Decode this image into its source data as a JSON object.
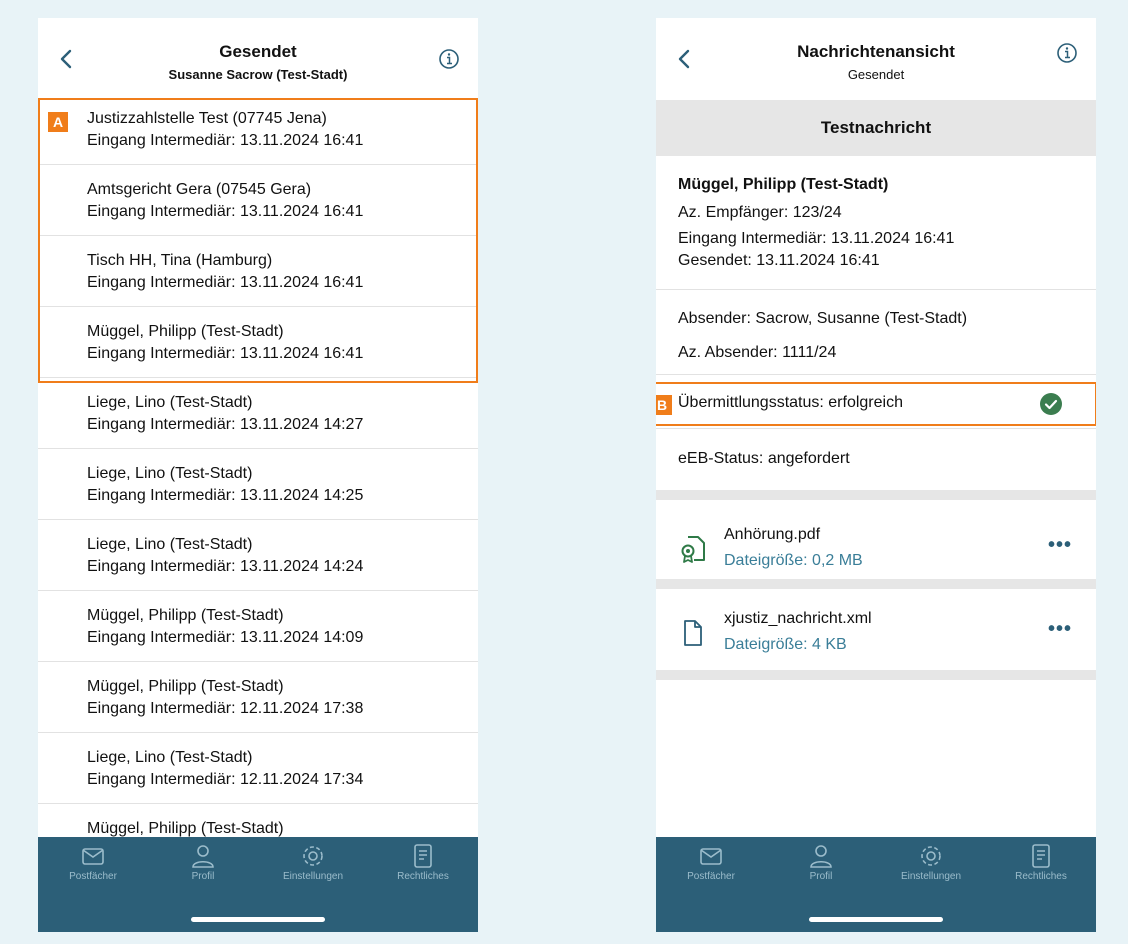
{
  "left": {
    "header": {
      "title": "Gesendet",
      "subtitle": "Susanne Sacrow (Test-Stadt)"
    },
    "badge": "A",
    "messages": [
      {
        "sender": "Justizzahlstelle Test (07745 Jena)",
        "received": "Eingang Intermediär: 13.11.2024 16:41"
      },
      {
        "sender": "Amtsgericht Gera (07545 Gera)",
        "received": "Eingang Intermediär: 13.11.2024 16:41"
      },
      {
        "sender": "Tisch HH, Tina (Hamburg)",
        "received": "Eingang Intermediär: 13.11.2024 16:41"
      },
      {
        "sender": "Müggel, Philipp (Test-Stadt)",
        "received": "Eingang Intermediär: 13.11.2024 16:41"
      },
      {
        "sender": "Liege, Lino (Test-Stadt)",
        "received": "Eingang Intermediär: 13.11.2024 14:27"
      },
      {
        "sender": "Liege, Lino (Test-Stadt)",
        "received": "Eingang Intermediär: 13.11.2024 14:25"
      },
      {
        "sender": "Liege, Lino (Test-Stadt)",
        "received": "Eingang Intermediär: 13.11.2024 14:24"
      },
      {
        "sender": "Müggel, Philipp (Test-Stadt)",
        "received": "Eingang Intermediär: 13.11.2024 14:09"
      },
      {
        "sender": "Müggel, Philipp (Test-Stadt)",
        "received": "Eingang Intermediär: 12.11.2024 17:38"
      },
      {
        "sender": "Liege, Lino (Test-Stadt)",
        "received": "Eingang Intermediär: 12.11.2024 17:34"
      },
      {
        "sender": "Müggel, Philipp (Test-Stadt)",
        "received": ""
      }
    ]
  },
  "right": {
    "header": {
      "title": "Nachrichtenansicht",
      "subtitle": "Gesendet"
    },
    "subject": "Testnachricht",
    "recipient": {
      "name": "Müggel, Philipp (Test-Stadt)",
      "az_empfaenger": "Az. Empfänger: 123/24",
      "eingang": "Eingang Intermediär: 13.11.2024 16:41",
      "gesendet": "Gesendet: 13.11.2024 16:41"
    },
    "sender": {
      "absender": "Absender: Sacrow, Susanne (Test-Stadt)",
      "az_absender": "Az. Absender: 1111/24"
    },
    "badge": "B",
    "status": "Übermittlungsstatus: erfolgreich",
    "status_color": "#3b7d4f",
    "eeb": "eEB-Status: angefordert",
    "files": [
      {
        "name": "Anhörung.pdf",
        "size": "Dateigröße: 0,2 MB",
        "icon": "certified-file-icon",
        "more": "•••"
      },
      {
        "name": "xjustiz_nachricht.xml",
        "size": "Dateigröße: 4 KB",
        "icon": "file-icon",
        "more": "•••"
      }
    ]
  },
  "tabbar": {
    "items": [
      {
        "label": "Postfächer",
        "icon": "mail-icon"
      },
      {
        "label": "Profil",
        "icon": "user-icon"
      },
      {
        "label": "Einstellungen",
        "icon": "gear-icon"
      },
      {
        "label": "Rechtliches",
        "icon": "document-icon"
      }
    ]
  },
  "colors": {
    "accent": "#f07d1a",
    "tabbar": "#2c5f78",
    "link": "#3a7e98",
    "background": "#e8f3f7"
  }
}
